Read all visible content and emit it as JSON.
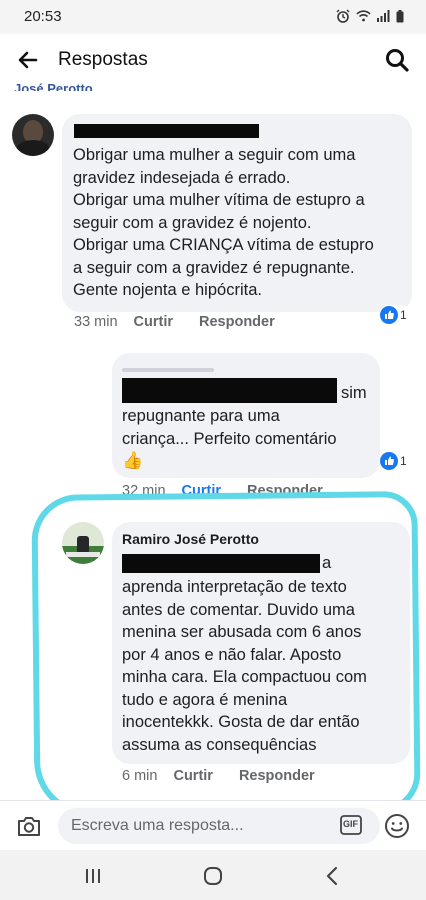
{
  "status_bar": {
    "time": "20:53",
    "icons": [
      "alarm-icon",
      "wifi-icon",
      "signal-icon",
      "battery-icon"
    ]
  },
  "header": {
    "title": "Respostas",
    "back_icon": "arrow-left-icon",
    "search_icon": "search-icon"
  },
  "cut_off_name": "José Perotto",
  "comments": [
    {
      "text": "Obrigar uma mulher a seguir com uma\ngravidez indesejada é errado.\nObrigar uma mulher vítima de estupro a\nseguir com a gravidez é nojento.\nObrigar uma CRIANÇA vítima de estupro\na seguir com a gravidez é repugnante.\nGente nojenta e hipócrita.",
      "reaction_count": "1",
      "time": "33 min",
      "like_label": "Curtir",
      "reply_label": "Responder"
    },
    {
      "text_inline": "sim",
      "text": "repugnante para uma\ncriança... Perfeito comentário",
      "emoji": "👍",
      "reaction_count": "1",
      "time": "32 min",
      "like_label": "Curtir",
      "reply_label": "Responder"
    },
    {
      "author": "Ramiro José Perotto",
      "mention_suffix": "a",
      "text": "aprenda interpretação de texto\nantes de comentar. Duvido uma\nmenina ser abusada com 6 anos\npor 4 anos e não falar. Aposto\nminha cara. Ela compactuou com\ntudo e agora é menina\ninocentekkk. Gosta de dar então\nassuma as consequências",
      "time": "6 min",
      "like_label": "Curtir",
      "reply_label": "Responder"
    }
  ],
  "compose": {
    "placeholder": "Escreva uma resposta...",
    "gif_label": "GIF"
  },
  "colors": {
    "bubble": "#f0f2f5",
    "liked_blue": "#1877f2",
    "highlight": "#5fd8e8"
  }
}
